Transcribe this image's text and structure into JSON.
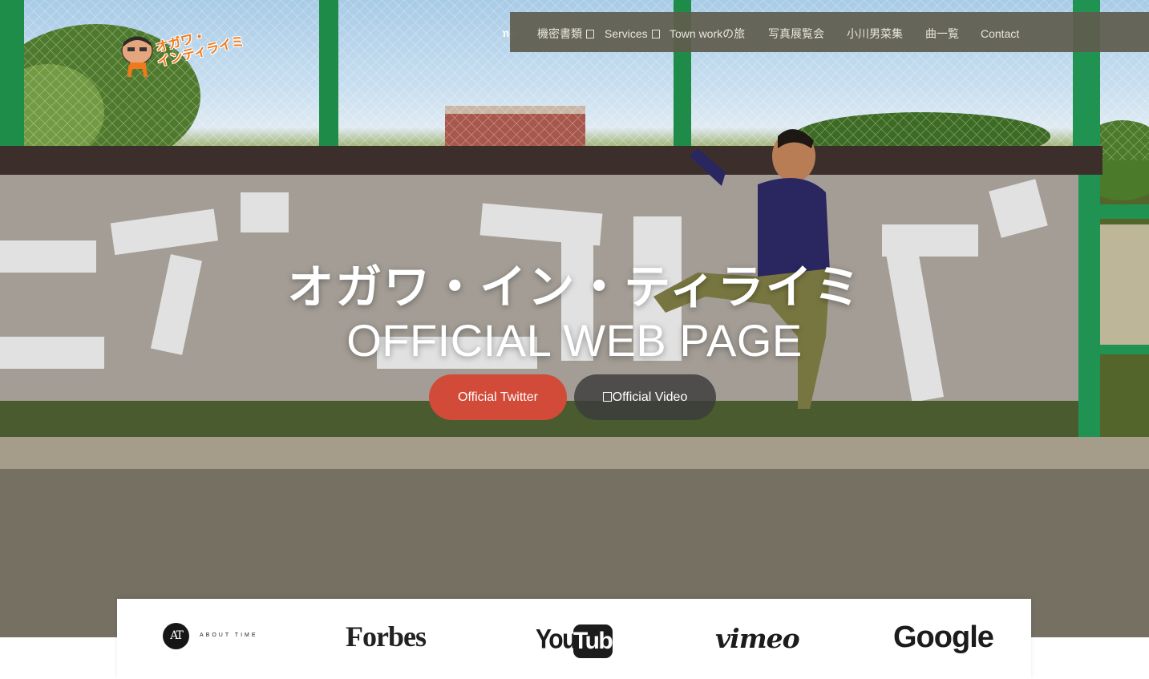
{
  "logo": {
    "line1": "オガワ・",
    "line2": "インティライミ",
    "icon": "cartoon-man-logo-icon"
  },
  "nav": {
    "home_label": "Home",
    "items": [
      {
        "label": "機密書類",
        "has_dropdown": true
      },
      {
        "label": "Services",
        "has_dropdown": true
      },
      {
        "label": "Town workの旅",
        "has_dropdown": false
      },
      {
        "label": "写真展覧会",
        "has_dropdown": false
      },
      {
        "label": "小川男菜集",
        "has_dropdown": false
      },
      {
        "label": "曲一覧",
        "has_dropdown": false
      },
      {
        "label": "Contact",
        "has_dropdown": false
      }
    ]
  },
  "hero": {
    "title_jp": "オガワ・イン・ティライミ",
    "title_en": "OFFICIAL WEB PAGE",
    "btn_twitter": "Official Twitter",
    "btn_video": "Official Video"
  },
  "brands": {
    "about_time_mark": "AT",
    "about_time_text": "ABOUT TIME",
    "forbes": "Forbes",
    "youtube_you": "You",
    "youtube_tube": "Tube",
    "vimeo": "vimeo",
    "google": "Google"
  },
  "colors": {
    "nav_bg": "#605c4e",
    "twitter_button": "#d24a38",
    "video_button": "#3c3c3c",
    "logo_orange": "#f07a1b"
  }
}
